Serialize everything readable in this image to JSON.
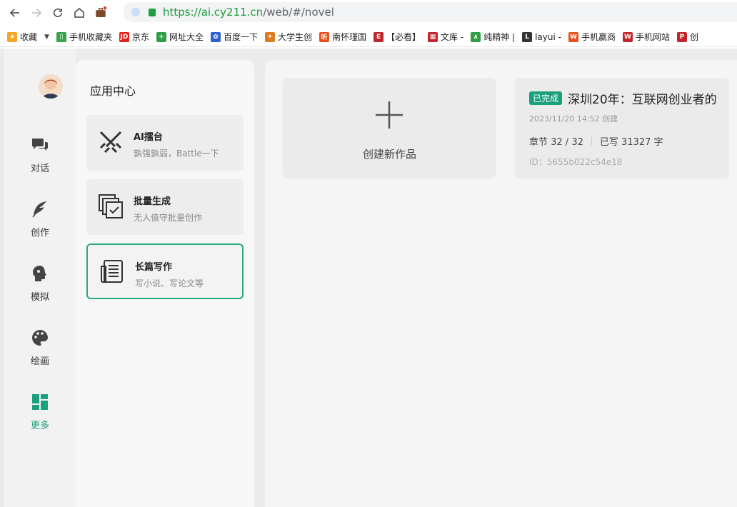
{
  "browser": {
    "url_proto": "https://",
    "url_host": "ai.cy211.cn",
    "url_path": "/web/#/novel"
  },
  "bookmarks": [
    {
      "label": "收藏",
      "icon": "star-icon",
      "color": "#f5a623"
    },
    {
      "label": "手机收藏夹",
      "icon": "phone-icon",
      "color": "#37a34a"
    },
    {
      "label": "京东",
      "icon": "jd-icon",
      "color": "#e1251b"
    },
    {
      "label": "网址大全",
      "icon": "plus-circle-icon",
      "color": "#2f9e44"
    },
    {
      "label": "百度一下",
      "icon": "baidu-icon",
      "color": "#3060d0"
    },
    {
      "label": "大学生创",
      "icon": "flame-icon",
      "color": "#e07b20"
    },
    {
      "label": "南怀瑾国",
      "icon": "ting-icon",
      "color": "#e8501b"
    },
    {
      "label": "【必看】",
      "icon": "e-icon",
      "color": "#c0272d"
    },
    {
      "label": "文库 -",
      "icon": "wenku-icon",
      "color": "#c0272d"
    },
    {
      "label": "纯精神 |",
      "icon": "compass-icon",
      "color": "#2f9e44"
    },
    {
      "label": "layui -",
      "icon": "layui-icon",
      "color": "#333333"
    },
    {
      "label": "手机赢商",
      "icon": "wn-icon",
      "color": "#e8501b"
    },
    {
      "label": "手机网站",
      "icon": "w-icon",
      "color": "#c0272d"
    },
    {
      "label": "创",
      "icon": "pp-icon",
      "color": "#c0272d"
    }
  ],
  "rail": {
    "items": [
      {
        "label": "对话",
        "icon": "chat-icon"
      },
      {
        "label": "创作",
        "icon": "feather-icon"
      },
      {
        "label": "模拟",
        "icon": "head-icon"
      },
      {
        "label": "绘画",
        "icon": "palette-icon"
      },
      {
        "label": "更多",
        "icon": "grid-icon",
        "active": true
      }
    ]
  },
  "panel": {
    "title": "应用中心",
    "cards": [
      {
        "title": "AI擂台",
        "sub": "孰强孰弱，Battle一下",
        "icon": "swords-icon"
      },
      {
        "title": "批量生成",
        "sub": "无人值守批量创作",
        "icon": "batch-check-icon"
      },
      {
        "title": "长篇写作",
        "sub": "写小说、写论文等",
        "icon": "scroll-icon",
        "active": true
      }
    ]
  },
  "main": {
    "create_label": "创建新作品",
    "work": {
      "badge": "已完成",
      "title": "深圳20年：互联网创业者的",
      "created": "2023/11/20 14:52 创建",
      "chapters": "章节 32 / 32",
      "written": "已写 31327 字",
      "id": "ID：5655b022c54e18"
    }
  },
  "colors": {
    "accent": "#1aa07c"
  }
}
